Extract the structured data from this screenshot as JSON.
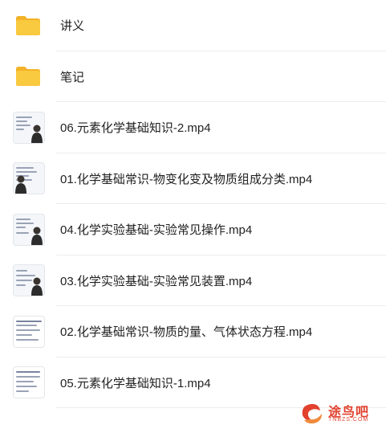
{
  "files": [
    {
      "type": "folder",
      "name": "讲义",
      "icon": "folder-icon"
    },
    {
      "type": "folder",
      "name": "笔记",
      "icon": "folder-icon"
    },
    {
      "type": "video",
      "name": "06.元素化学基础知识-2.mp4",
      "icon": "video-thumbnail"
    },
    {
      "type": "video",
      "name": "01.化学基础常识-物变化变及物质组成分类.mp4",
      "icon": "video-thumbnail"
    },
    {
      "type": "video",
      "name": "04.化学实验基础-实验常见操作.mp4",
      "icon": "video-thumbnail"
    },
    {
      "type": "video",
      "name": "03.化学实验基础-实验常见装置.mp4",
      "icon": "video-thumbnail"
    },
    {
      "type": "video",
      "name": "02.化学基础常识-物质的量、气体状态方程.mp4",
      "icon": "video-thumbnail"
    },
    {
      "type": "video",
      "name": "05.元素化学基础知识-1.mp4",
      "icon": "video-thumbnail"
    }
  ],
  "watermark": {
    "text": "途鸟吧",
    "subtext": "TNBZS.COM"
  },
  "colors": {
    "folder": "#f7c13a",
    "folder_back": "#f3b227",
    "accent": "#e2412e"
  }
}
